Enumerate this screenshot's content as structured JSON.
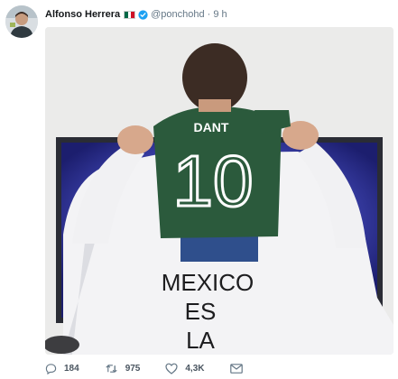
{
  "tweet": {
    "author": {
      "name": "Alfonso Herrera",
      "handle": "@ponchohd",
      "avatar_icon": "profile-photo",
      "flag_icon": "mexico-flag-icon",
      "verified_icon": "verified-badge-icon"
    },
    "separator": "·",
    "time": "9 h",
    "media": {
      "description_icon": "photo",
      "jersey_back_text": [
        "MEXICO",
        "ES",
        "LA"
      ],
      "child_jersey_name": "DANT",
      "child_jersey_number": "10"
    },
    "actions": {
      "reply": {
        "icon": "reply-icon",
        "count": "184"
      },
      "retweet": {
        "icon": "retweet-icon",
        "count": "975"
      },
      "like": {
        "icon": "heart-icon",
        "count": "4,3K"
      },
      "share": {
        "icon": "mail-icon"
      }
    },
    "colors": {
      "name": "#14171a",
      "meta": "#657786",
      "verified": "#1da1f2",
      "jersey_green": "#2b5a3c"
    }
  }
}
